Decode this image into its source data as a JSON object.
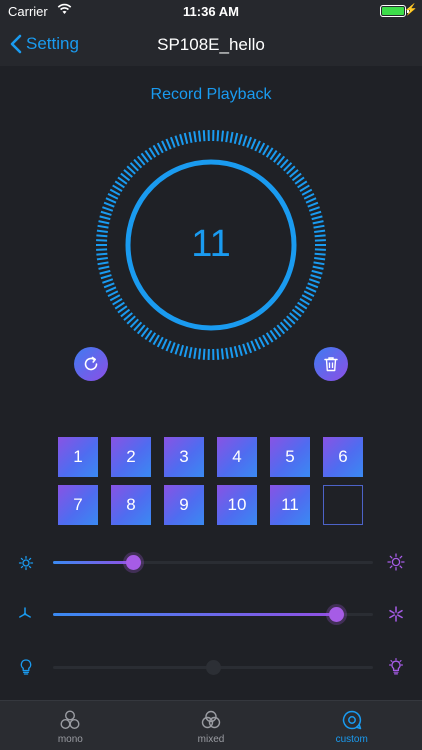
{
  "status_bar": {
    "carrier": "Carrier",
    "time": "11:36 AM",
    "battery_level": 1.0
  },
  "nav": {
    "back_label": "Setting",
    "title": "SP108E_hello"
  },
  "playback": {
    "title": "Record Playback",
    "current_value": "11"
  },
  "slots": [
    {
      "label": "1",
      "filled": true
    },
    {
      "label": "2",
      "filled": true
    },
    {
      "label": "3",
      "filled": true
    },
    {
      "label": "4",
      "filled": true
    },
    {
      "label": "5",
      "filled": true
    },
    {
      "label": "6",
      "filled": true
    },
    {
      "label": "7",
      "filled": true
    },
    {
      "label": "8",
      "filled": true
    },
    {
      "label": "9",
      "filled": true
    },
    {
      "label": "10",
      "filled": true
    },
    {
      "label": "11",
      "filled": true
    },
    {
      "label": "",
      "filled": false
    }
  ],
  "sliders": [
    {
      "name": "brightness",
      "icon_min": "sun-small-icon",
      "icon_max": "sun-large-icon",
      "value": 0.25,
      "enabled": true
    },
    {
      "name": "speed",
      "icon_min": "fan-slow-icon",
      "icon_max": "fan-fast-icon",
      "value": 0.885,
      "enabled": true
    },
    {
      "name": "white-level",
      "icon_min": "bulb-icon",
      "icon_max": "bulb-bright-icon",
      "value": 0.5,
      "enabled": false
    }
  ],
  "tabs": [
    {
      "label": "mono",
      "icon": "mono-circles-icon",
      "active": false
    },
    {
      "label": "mixed",
      "icon": "mixed-circles-icon",
      "active": false
    },
    {
      "label": "custom",
      "icon": "custom-chat-icon",
      "active": true
    }
  ],
  "colors": {
    "accent": "#1a9bf0",
    "purple": "#9150e3",
    "background": "#1f2126"
  }
}
